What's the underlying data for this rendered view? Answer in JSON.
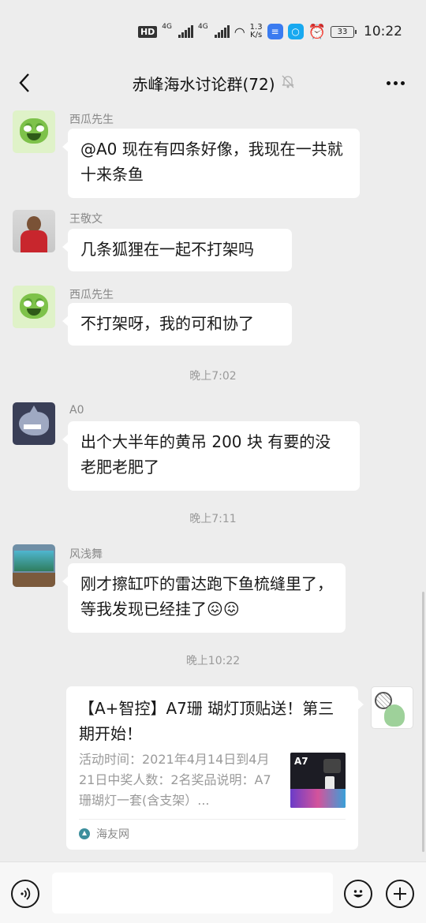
{
  "status_bar": {
    "hd": "HD",
    "signal1": "4G",
    "signal2": "4G",
    "speed_value": "1.3",
    "speed_unit": "K/s",
    "battery": "33",
    "time": "10:22"
  },
  "header": {
    "title": "赤峰海水讨论群(72)",
    "mute_icon": "bell-off-icon"
  },
  "messages": [
    {
      "type": "text",
      "sender": "西瓜先生",
      "avatar": "green-pig",
      "text": "@A0  现在有四条好像，我现在一共就十来条鱼"
    },
    {
      "type": "text",
      "sender": "王敬文",
      "avatar": "person-photo",
      "text": "几条狐狸在一起不打架吗"
    },
    {
      "type": "text",
      "sender": "西瓜先生",
      "avatar": "green-pig",
      "text": "不打架呀，我的可和协了"
    },
    {
      "type": "time",
      "text": "晚上7:02"
    },
    {
      "type": "text",
      "sender": "A0",
      "avatar": "cartoon-shark",
      "text": "出个大半年的黄吊 200 块 有要的没  老肥老肥了"
    },
    {
      "type": "time",
      "text": "晚上7:11"
    },
    {
      "type": "text",
      "sender": "风浅舞",
      "avatar": "aquarium-photo",
      "text": "刚才擦缸吓的雷达跑下鱼梳缝里了，等我发现已经挂了😖😖"
    },
    {
      "type": "time",
      "text": "晚上10:22"
    },
    {
      "type": "link_card",
      "avatar": "dinosaur-with-net",
      "title": "【A+智控】A7珊 瑚灯顶贴送！第三期开始！",
      "description": "活动时间：2021年4月14日到4月21日中奖人数：2名奖品说明：A7珊瑚灯一套(含支架）...",
      "thumbnail_label": "A7",
      "source": "海友网"
    }
  ],
  "input_bar": {
    "placeholder": "",
    "voice_icon": "voice-icon",
    "emoji_icon": "emoji-icon",
    "plus_icon": "plus-icon"
  }
}
